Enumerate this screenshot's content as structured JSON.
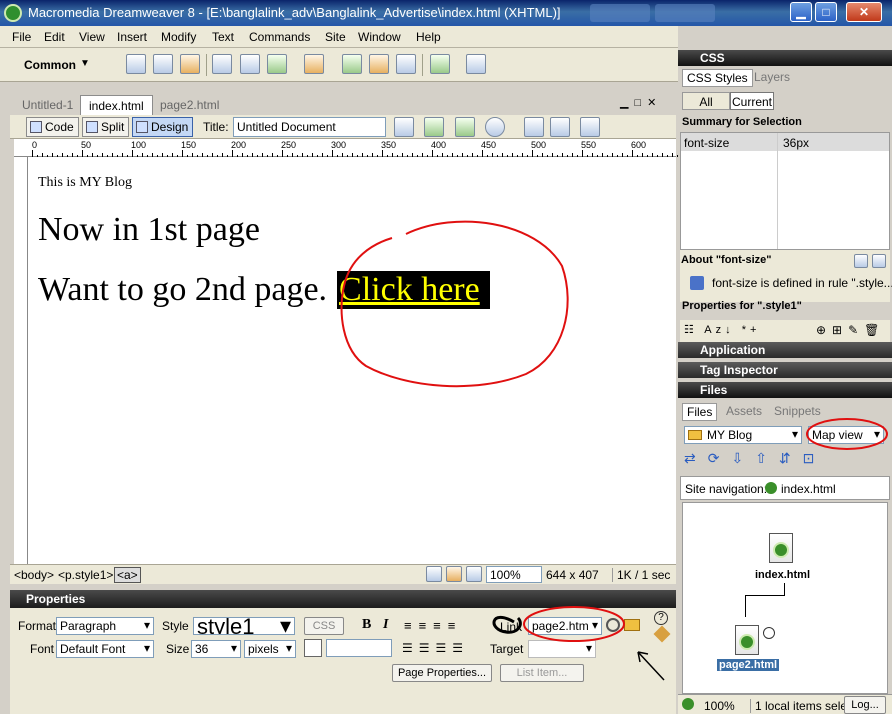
{
  "window": {
    "title": "Macromedia Dreamweaver 8 - [E:\\banglalink_adv\\Banglalink_Advertise\\index.html (XHTML)]",
    "minimize": "▁",
    "maximize": "□",
    "close": "✕"
  },
  "menu": [
    "File",
    "Edit",
    "View",
    "Insert",
    "Modify",
    "Text",
    "Commands",
    "Site",
    "Window",
    "Help"
  ],
  "insert_bar": {
    "category": "Common"
  },
  "doc_tabs": [
    "Untitled-1",
    "index.html",
    "page2.html"
  ],
  "doc_toolbar": {
    "code": "Code",
    "split": "Split",
    "design": "Design",
    "title_label": "Title:",
    "title_value": "Untitled Document"
  },
  "ruler": [
    "0",
    "50",
    "100",
    "150",
    "200",
    "250",
    "300",
    "350",
    "400",
    "450",
    "500",
    "550",
    "600"
  ],
  "page": {
    "blog_line": "This is MY Blog",
    "heading": "Now in 1st page",
    "prompt": "Want to go 2nd page.",
    "link_text": "Click here"
  },
  "status": {
    "tag_body": "<body>",
    "tag_p": "<p.style1>",
    "tag_a": "<a>",
    "zoom": "100%",
    "dims": "644 x 407",
    "filesize": "1K / 1 sec"
  },
  "properties": {
    "header": "Properties",
    "format_label": "Format",
    "format_value": "Paragraph",
    "style_label": "Style",
    "style_value": "style1",
    "css_btn": "CSS",
    "font_label": "Font",
    "font_value": "Default Font",
    "size_label": "Size",
    "size_value": "36",
    "unit_value": "pixels",
    "link_label": "Link",
    "link_value": "page2.htm",
    "target_label": "Target",
    "page_props": "Page Properties...",
    "list_item": "List Item...",
    "bold": "B",
    "italic": "I"
  },
  "css_panel": {
    "header": "CSS",
    "tab_styles": "CSS Styles",
    "tab_layers": "Layers",
    "btn_all": "All",
    "btn_current": "Current",
    "summary_title": "Summary for Selection",
    "prop_name": "font-size",
    "prop_value": "36px",
    "about_title": "About \"font-size\"",
    "about_text": "font-size is defined in rule \".style...",
    "props_for": "Properties for \".style1\""
  },
  "collapsed_panels": [
    "Application",
    "Tag Inspector"
  ],
  "files_panel": {
    "header": "Files",
    "tab_files": "Files",
    "tab_assets": "Assets",
    "tab_snippets": "Snippets",
    "site": "MY Blog",
    "view": "Map view",
    "site_nav_label": "Site navigation:",
    "site_nav_file": "index.html",
    "map_root": "index.html",
    "map_child": "page2.html",
    "zoom": "100%",
    "status_text": "1 local items sele",
    "log_btn": "Log..."
  },
  "colors": {
    "annotation": "#e01010",
    "link_fg": "#ffff00",
    "link_bg": "#000000"
  }
}
